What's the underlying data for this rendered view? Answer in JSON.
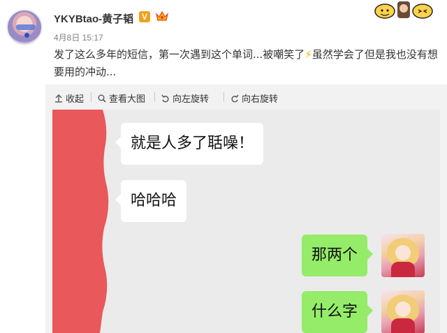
{
  "post": {
    "username": "YKYBtao-黄子韬",
    "verified_badge": "V",
    "timestamp": "4月8日 15:17",
    "text_part1": "发了这么多年的短信，第一次遇到这个单词...被嘲笑了",
    "bolt": "⚡",
    "text_part2": "虽然学会了但是我也没有想要用的冲动..."
  },
  "toolbar": {
    "collapse_label": "收起",
    "view_large_label": "查看大图",
    "rotate_left_label": "向左旋转",
    "rotate_right_label": "向右旋转"
  },
  "chat": {
    "messages": [
      {
        "side": "left",
        "text": "就是人多了聒噪！"
      },
      {
        "side": "left",
        "text": "哈哈哈"
      },
      {
        "side": "right",
        "text": "那两个"
      },
      {
        "side": "right",
        "text": "什么字"
      }
    ]
  },
  "colors": {
    "bubble_right": "#95ec69",
    "bubble_left": "#ffffff",
    "redaction": "#e9585a",
    "vip_badge": "#f0a21b"
  },
  "icons": {
    "collapse": "arrow-up-icon",
    "view_large": "magnifier-icon",
    "rotate_left": "rotate-left-icon",
    "rotate_right": "rotate-right-icon"
  }
}
